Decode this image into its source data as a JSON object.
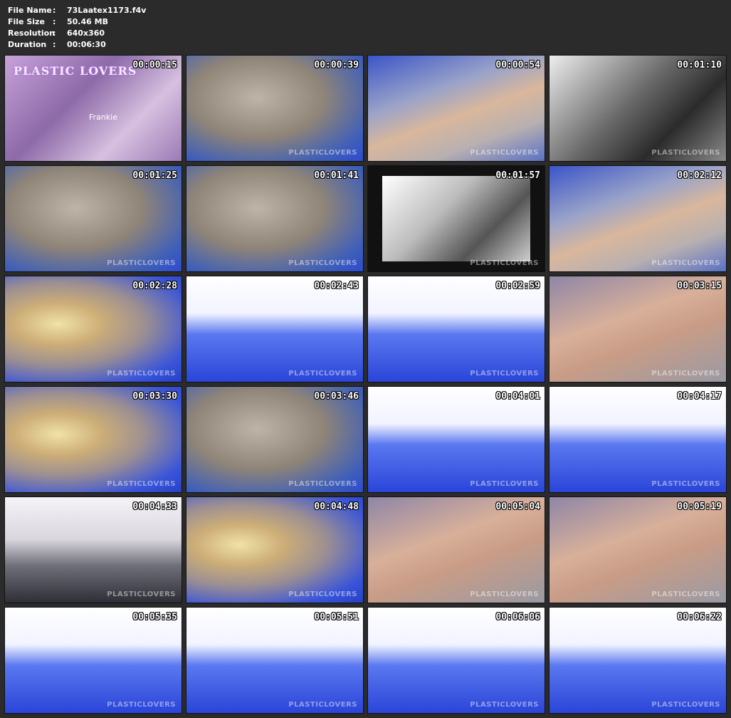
{
  "meta": {
    "file_name_label": "File Name",
    "file_name": "73Laatex1173.f4v",
    "file_size_label": "File Size",
    "file_size": "50.46 MB",
    "resolution_label": "Resolution",
    "resolution": "640x360",
    "duration_label": "Duration",
    "duration": "00:06:30",
    "separator": ":"
  },
  "first_thumb": {
    "logo": "PLASTIC LOVERS",
    "caption": "Frankie"
  },
  "watermark": "PLASTICLOVERS",
  "thumbnails": [
    {
      "time": "00:00:15",
      "palette": "purple"
    },
    {
      "time": "00:00:39",
      "palette": "clear"
    },
    {
      "time": "00:00:54",
      "palette": "hand"
    },
    {
      "time": "00:01:10",
      "palette": "bw"
    },
    {
      "time": "00:01:25",
      "palette": "clear"
    },
    {
      "time": "00:01:41",
      "palette": "clear"
    },
    {
      "time": "00:01:57",
      "palette": "bwbox"
    },
    {
      "time": "00:02:12",
      "palette": "hand"
    },
    {
      "time": "00:02:28",
      "palette": "blonde"
    },
    {
      "time": "00:02:43",
      "palette": "bed"
    },
    {
      "time": "00:02:59",
      "palette": "bed"
    },
    {
      "time": "00:03:15",
      "palette": "skin"
    },
    {
      "time": "00:03:30",
      "palette": "blonde"
    },
    {
      "time": "00:03:46",
      "palette": "clear"
    },
    {
      "time": "00:04:01",
      "palette": "bed"
    },
    {
      "time": "00:04:17",
      "palette": "bed"
    },
    {
      "time": "00:04:33",
      "palette": "bedgray"
    },
    {
      "time": "00:04:48",
      "palette": "blonde"
    },
    {
      "time": "00:05:04",
      "palette": "skin"
    },
    {
      "time": "00:05:19",
      "palette": "skin"
    },
    {
      "time": "00:05:35",
      "palette": "bed"
    },
    {
      "time": "00:05:51",
      "palette": "bed"
    },
    {
      "time": "00:06:06",
      "palette": "bed"
    },
    {
      "time": "00:06:22",
      "palette": "bed"
    }
  ]
}
